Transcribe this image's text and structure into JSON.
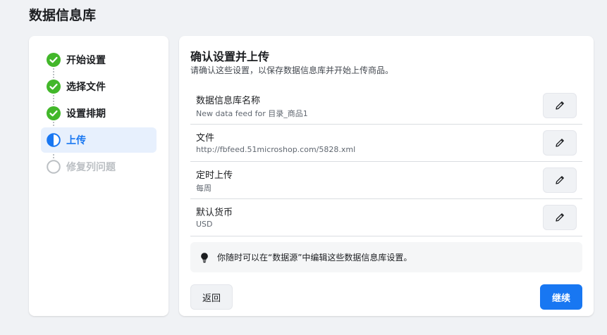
{
  "page": {
    "title": "数据信息库"
  },
  "colors": {
    "accent": "#1877f2",
    "done": "#42b72a",
    "future": "#bcc0c4"
  },
  "steps": [
    {
      "label": "开始设置",
      "status": "done",
      "icon": "check-circle-icon"
    },
    {
      "label": "选择文件",
      "status": "done",
      "icon": "check-circle-icon"
    },
    {
      "label": "设置排期",
      "status": "done",
      "icon": "check-circle-icon"
    },
    {
      "label": "上传",
      "status": "active",
      "icon": "half-circle-icon"
    },
    {
      "label": "修复列问题",
      "status": "future",
      "icon": "empty-circle-icon"
    }
  ],
  "confirm": {
    "title": "确认设置并上传",
    "subtitle": "请确认这些设置，以保存数据信息库并开始上传商品。",
    "fields": [
      {
        "label": "数据信息库名称",
        "value": "New data feed for 目录_商品1",
        "edit_icon": "pencil-icon"
      },
      {
        "label": "文件",
        "value": "http://fbfeed.51microshop.com/5828.xml",
        "edit_icon": "pencil-icon"
      },
      {
        "label": "定时上传",
        "value": "每周",
        "edit_icon": "pencil-icon"
      },
      {
        "label": "默认货币",
        "value": "USD",
        "edit_icon": "pencil-icon"
      }
    ],
    "tip": {
      "icon": "lightbulb-icon",
      "text": "你随时可以在“数据源”中编辑这些数据信息库设置。"
    }
  },
  "actions": {
    "back_label": "返回",
    "continue_label": "继续"
  }
}
